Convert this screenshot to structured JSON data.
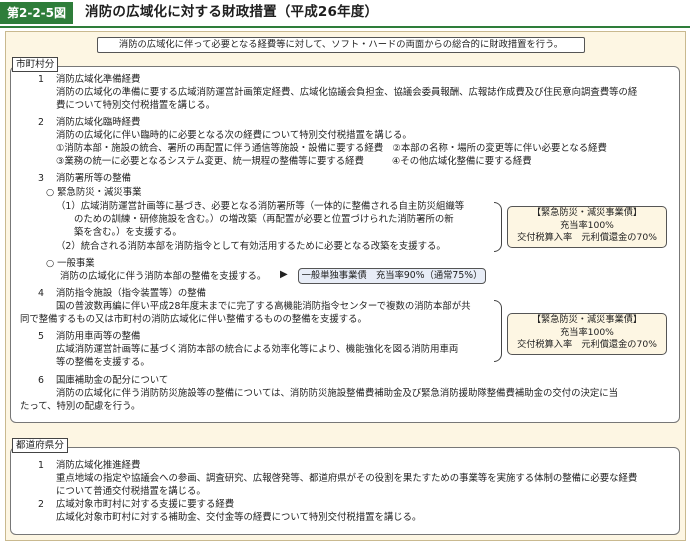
{
  "header": {
    "figure_label": "第2-2-5図",
    "title": "消防の広域化に対する財政措置（平成26年度）"
  },
  "summary": "消防の広域化に伴って必要となる経費等に対して、ソフト・ハードの両面からの総合的に財政措置を行う。",
  "municipal": {
    "tag": "市町村分",
    "items": [
      {
        "num": "1",
        "title": "消防広域化準備経費",
        "lines": [
          "消防の広域化の準備に要する広域消防運営計画策定経費、広域化協議会負担金、協議会委員報酬、広報誌作成費及び住民意向調査費等の経",
          "費について特別交付税措置を講じる。"
        ]
      },
      {
        "num": "2",
        "title": "消防広域化臨時経費",
        "lines": [
          "消防の広域化に伴い臨時的に必要となる次の経費について特別交付税措置を講じる。",
          "①消防本部・施設の統合、署所の再配置に伴う通信等施設・設備に要する経費　②本部の名称・場所の変更等に伴い必要となる経費",
          "③業務の統一に必要となるシステム変更、統一規程の整備等に要する経費　　　④その他広域化整備に要する経費"
        ]
      },
      {
        "num": "3",
        "title": "消防署所等の整備",
        "sub1": "○ 緊急防災・減災事業",
        "sub1_lines": [
          "（1）広域消防運営計画等に基づき、必要となる消防署所等（一体的に整備される自主防災組織等",
          "のための訓練・研修施設を含む。）の増改築（再配置が必要と位置づけられた消防署所の新",
          "築を含む。）を支援する。",
          "（2）統合される消防本部を消防指令として有効活用するために必要となる改築を支援する。"
        ],
        "sub2": "○ 一般事業",
        "sub2_line": "消防の広域化に伴う消防本部の整備を支援する。"
      },
      {
        "num": "4",
        "title": "消防指令施設（指令装置等）の整備",
        "lines": [
          "国の普波数再編に伴い平成28年度末までに完了する高機能消防指令センターで複数の消防本部が共",
          "同で整備するもの又は市町村の消防広域化に伴い整備するものの整備を支援する。"
        ]
      },
      {
        "num": "5",
        "title": "消防用車両等の整備",
        "lines": [
          "広域消防運営計画等に基づく消防本部の統合による効率化等により、機能強化を図る消防用車両",
          "等の整備を支援する。"
        ]
      },
      {
        "num": "6",
        "title": "国庫補助金の配分について",
        "lines": [
          "消防の広域化に伴う消防防災施設等の整備については、消防防災施設整備費補助金及び緊急消防援助隊整備費補助金の交付の決定に当",
          "たって、特別の配慮を行う。"
        ]
      }
    ],
    "callout1": [
      "【緊急防災・減災事業債】",
      "充当率100%",
      "交付税算入率　元利償還金の70%"
    ],
    "callout2": [
      "【緊急防災・減災事業債】",
      "充当率100%",
      "交付税算入率　元利償還金の70%"
    ],
    "general_bond": "一般単独事業債　充当率90%（通常75%）",
    "arrow": "▶"
  },
  "prefecture": {
    "tag": "都道府県分",
    "items": [
      {
        "num": "1",
        "title": "消防広域化推進経費",
        "lines": [
          "重点地域の指定や協議会への参画、調査研究、広報啓発等、都道府県がその役割を果たすための事業等を実施する体制の整備に必要な経費",
          "について普通交付税措置を講じる。"
        ]
      },
      {
        "num": "2",
        "title": "広域対象市町村に対する支援に要する経費",
        "lines": [
          "広域化対象市町村に対する補助金、交付金等の経費について特別交付税措置を講じる。"
        ]
      }
    ]
  }
}
